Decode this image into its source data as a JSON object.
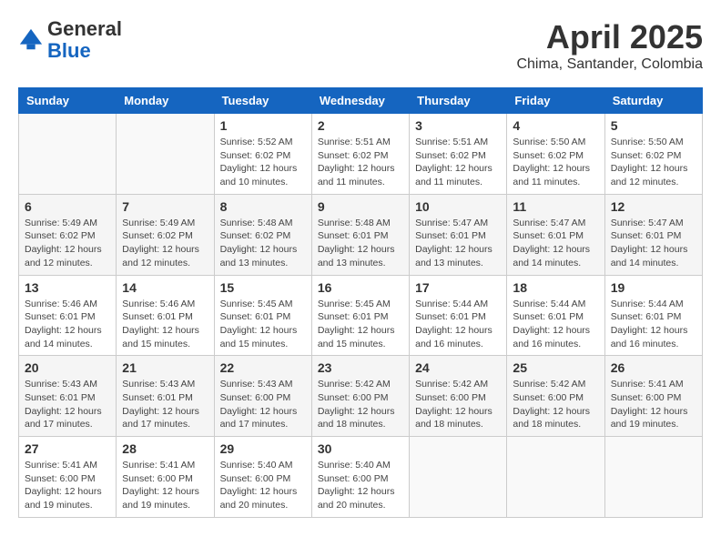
{
  "header": {
    "logo_general": "General",
    "logo_blue": "Blue",
    "month_year": "April 2025",
    "location": "Chima, Santander, Colombia"
  },
  "weekdays": [
    "Sunday",
    "Monday",
    "Tuesday",
    "Wednesday",
    "Thursday",
    "Friday",
    "Saturday"
  ],
  "weeks": [
    [
      {
        "day": "",
        "info": ""
      },
      {
        "day": "",
        "info": ""
      },
      {
        "day": "1",
        "info": "Sunrise: 5:52 AM\nSunset: 6:02 PM\nDaylight: 12 hours and 10 minutes."
      },
      {
        "day": "2",
        "info": "Sunrise: 5:51 AM\nSunset: 6:02 PM\nDaylight: 12 hours and 11 minutes."
      },
      {
        "day": "3",
        "info": "Sunrise: 5:51 AM\nSunset: 6:02 PM\nDaylight: 12 hours and 11 minutes."
      },
      {
        "day": "4",
        "info": "Sunrise: 5:50 AM\nSunset: 6:02 PM\nDaylight: 12 hours and 11 minutes."
      },
      {
        "day": "5",
        "info": "Sunrise: 5:50 AM\nSunset: 6:02 PM\nDaylight: 12 hours and 12 minutes."
      }
    ],
    [
      {
        "day": "6",
        "info": "Sunrise: 5:49 AM\nSunset: 6:02 PM\nDaylight: 12 hours and 12 minutes."
      },
      {
        "day": "7",
        "info": "Sunrise: 5:49 AM\nSunset: 6:02 PM\nDaylight: 12 hours and 12 minutes."
      },
      {
        "day": "8",
        "info": "Sunrise: 5:48 AM\nSunset: 6:02 PM\nDaylight: 12 hours and 13 minutes."
      },
      {
        "day": "9",
        "info": "Sunrise: 5:48 AM\nSunset: 6:01 PM\nDaylight: 12 hours and 13 minutes."
      },
      {
        "day": "10",
        "info": "Sunrise: 5:47 AM\nSunset: 6:01 PM\nDaylight: 12 hours and 13 minutes."
      },
      {
        "day": "11",
        "info": "Sunrise: 5:47 AM\nSunset: 6:01 PM\nDaylight: 12 hours and 14 minutes."
      },
      {
        "day": "12",
        "info": "Sunrise: 5:47 AM\nSunset: 6:01 PM\nDaylight: 12 hours and 14 minutes."
      }
    ],
    [
      {
        "day": "13",
        "info": "Sunrise: 5:46 AM\nSunset: 6:01 PM\nDaylight: 12 hours and 14 minutes."
      },
      {
        "day": "14",
        "info": "Sunrise: 5:46 AM\nSunset: 6:01 PM\nDaylight: 12 hours and 15 minutes."
      },
      {
        "day": "15",
        "info": "Sunrise: 5:45 AM\nSunset: 6:01 PM\nDaylight: 12 hours and 15 minutes."
      },
      {
        "day": "16",
        "info": "Sunrise: 5:45 AM\nSunset: 6:01 PM\nDaylight: 12 hours and 15 minutes."
      },
      {
        "day": "17",
        "info": "Sunrise: 5:44 AM\nSunset: 6:01 PM\nDaylight: 12 hours and 16 minutes."
      },
      {
        "day": "18",
        "info": "Sunrise: 5:44 AM\nSunset: 6:01 PM\nDaylight: 12 hours and 16 minutes."
      },
      {
        "day": "19",
        "info": "Sunrise: 5:44 AM\nSunset: 6:01 PM\nDaylight: 12 hours and 16 minutes."
      }
    ],
    [
      {
        "day": "20",
        "info": "Sunrise: 5:43 AM\nSunset: 6:01 PM\nDaylight: 12 hours and 17 minutes."
      },
      {
        "day": "21",
        "info": "Sunrise: 5:43 AM\nSunset: 6:01 PM\nDaylight: 12 hours and 17 minutes."
      },
      {
        "day": "22",
        "info": "Sunrise: 5:43 AM\nSunset: 6:00 PM\nDaylight: 12 hours and 17 minutes."
      },
      {
        "day": "23",
        "info": "Sunrise: 5:42 AM\nSunset: 6:00 PM\nDaylight: 12 hours and 18 minutes."
      },
      {
        "day": "24",
        "info": "Sunrise: 5:42 AM\nSunset: 6:00 PM\nDaylight: 12 hours and 18 minutes."
      },
      {
        "day": "25",
        "info": "Sunrise: 5:42 AM\nSunset: 6:00 PM\nDaylight: 12 hours and 18 minutes."
      },
      {
        "day": "26",
        "info": "Sunrise: 5:41 AM\nSunset: 6:00 PM\nDaylight: 12 hours and 19 minutes."
      }
    ],
    [
      {
        "day": "27",
        "info": "Sunrise: 5:41 AM\nSunset: 6:00 PM\nDaylight: 12 hours and 19 minutes."
      },
      {
        "day": "28",
        "info": "Sunrise: 5:41 AM\nSunset: 6:00 PM\nDaylight: 12 hours and 19 minutes."
      },
      {
        "day": "29",
        "info": "Sunrise: 5:40 AM\nSunset: 6:00 PM\nDaylight: 12 hours and 20 minutes."
      },
      {
        "day": "30",
        "info": "Sunrise: 5:40 AM\nSunset: 6:00 PM\nDaylight: 12 hours and 20 minutes."
      },
      {
        "day": "",
        "info": ""
      },
      {
        "day": "",
        "info": ""
      },
      {
        "day": "",
        "info": ""
      }
    ]
  ]
}
